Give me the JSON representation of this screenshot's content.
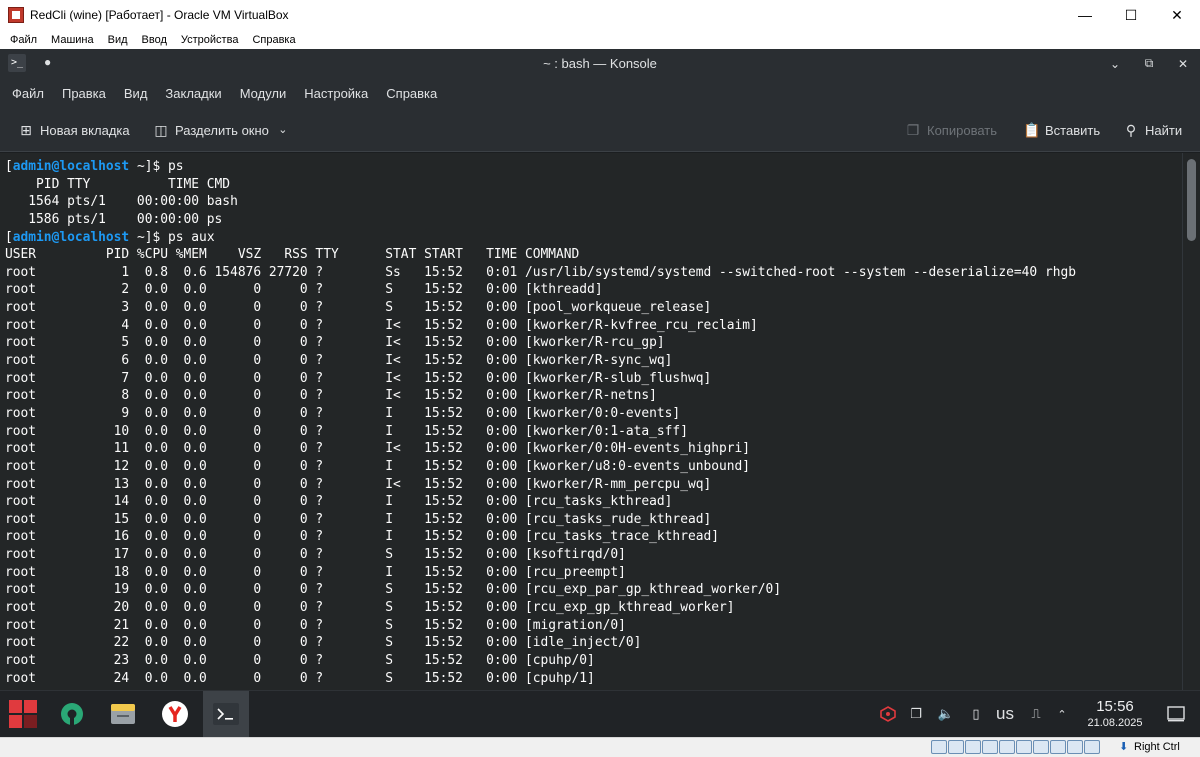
{
  "vbox": {
    "window_title": "RedCli (wine) [Работает] - Oracle VM VirtualBox",
    "controls": {
      "minimize": "—",
      "maximize": "☐",
      "close": "✕"
    },
    "menu": [
      "Файл",
      "Машина",
      "Вид",
      "Ввод",
      "Устройства",
      "Справка"
    ],
    "status": {
      "host_key": "Right Ctrl"
    }
  },
  "konsole": {
    "title": "~ : bash — Konsole",
    "pin_glyph": "●",
    "menu": [
      "Файл",
      "Правка",
      "Вид",
      "Закладки",
      "Модули",
      "Настройка",
      "Справка"
    ],
    "toolbar": {
      "new_tab": "Новая вкладка",
      "split_view": "Разделить окно",
      "copy": "Копировать",
      "paste": "Вставить",
      "find": "Найти"
    },
    "controls": {
      "minimize": "⌄",
      "maximize": "⧉",
      "close": "✕"
    }
  },
  "terminal": {
    "prompt_user": "admin@localhost",
    "prompt_dir": " ~",
    "commands": [
      "ps",
      "ps aux"
    ],
    "ps_output": [
      "    PID TTY          TIME CMD",
      "   1564 pts/1    00:00:00 bash",
      "   1586 pts/1    00:00:00 ps"
    ],
    "ps_aux_output": [
      "USER         PID %CPU %MEM    VSZ   RSS TTY      STAT START   TIME COMMAND",
      "root           1  0.8  0.6 154876 27720 ?        Ss   15:52   0:01 /usr/lib/systemd/systemd --switched-root --system --deserialize=40 rhgb",
      "root           2  0.0  0.0      0     0 ?        S    15:52   0:00 [kthreadd]",
      "root           3  0.0  0.0      0     0 ?        S    15:52   0:00 [pool_workqueue_release]",
      "root           4  0.0  0.0      0     0 ?        I<   15:52   0:00 [kworker/R-kvfree_rcu_reclaim]",
      "root           5  0.0  0.0      0     0 ?        I<   15:52   0:00 [kworker/R-rcu_gp]",
      "root           6  0.0  0.0      0     0 ?        I<   15:52   0:00 [kworker/R-sync_wq]",
      "root           7  0.0  0.0      0     0 ?        I<   15:52   0:00 [kworker/R-slub_flushwq]",
      "root           8  0.0  0.0      0     0 ?        I<   15:52   0:00 [kworker/R-netns]",
      "root           9  0.0  0.0      0     0 ?        I    15:52   0:00 [kworker/0:0-events]",
      "root          10  0.0  0.0      0     0 ?        I    15:52   0:00 [kworker/0:1-ata_sff]",
      "root          11  0.0  0.0      0     0 ?        I<   15:52   0:00 [kworker/0:0H-events_highpri]",
      "root          12  0.0  0.0      0     0 ?        I    15:52   0:00 [kworker/u8:0-events_unbound]",
      "root          13  0.0  0.0      0     0 ?        I<   15:52   0:00 [kworker/R-mm_percpu_wq]",
      "root          14  0.0  0.0      0     0 ?        I    15:52   0:00 [rcu_tasks_kthread]",
      "root          15  0.0  0.0      0     0 ?        I    15:52   0:00 [rcu_tasks_rude_kthread]",
      "root          16  0.0  0.0      0     0 ?        I    15:52   0:00 [rcu_tasks_trace_kthread]",
      "root          17  0.0  0.0      0     0 ?        S    15:52   0:00 [ksoftirqd/0]",
      "root          18  0.0  0.0      0     0 ?        I    15:52   0:00 [rcu_preempt]",
      "root          19  0.0  0.0      0     0 ?        S    15:52   0:00 [rcu_exp_par_gp_kthread_worker/0]",
      "root          20  0.0  0.0      0     0 ?        S    15:52   0:00 [rcu_exp_gp_kthread_worker]",
      "root          21  0.0  0.0      0     0 ?        S    15:52   0:00 [migration/0]",
      "root          22  0.0  0.0      0     0 ?        S    15:52   0:00 [idle_inject/0]",
      "root          23  0.0  0.0      0     0 ?        S    15:52   0:00 [cpuhp/0]",
      "root          24  0.0  0.0      0     0 ?        S    15:52   0:00 [cpuhp/1]"
    ]
  },
  "taskbar": {
    "apps": [
      "app-launcher-icon",
      "settings-gear-icon",
      "file-manager-icon",
      "yandex-browser-icon",
      "konsole-icon"
    ],
    "tray": {
      "keyboard_layout": "us"
    },
    "clock": {
      "time": "15:56",
      "date": "21.08.2025"
    }
  },
  "colors": {
    "terminal_bg": "#232627",
    "terminal_fg": "#fcfcfc",
    "prompt_user": "#1d99f3",
    "chrome_bg": "#2a2e32"
  }
}
